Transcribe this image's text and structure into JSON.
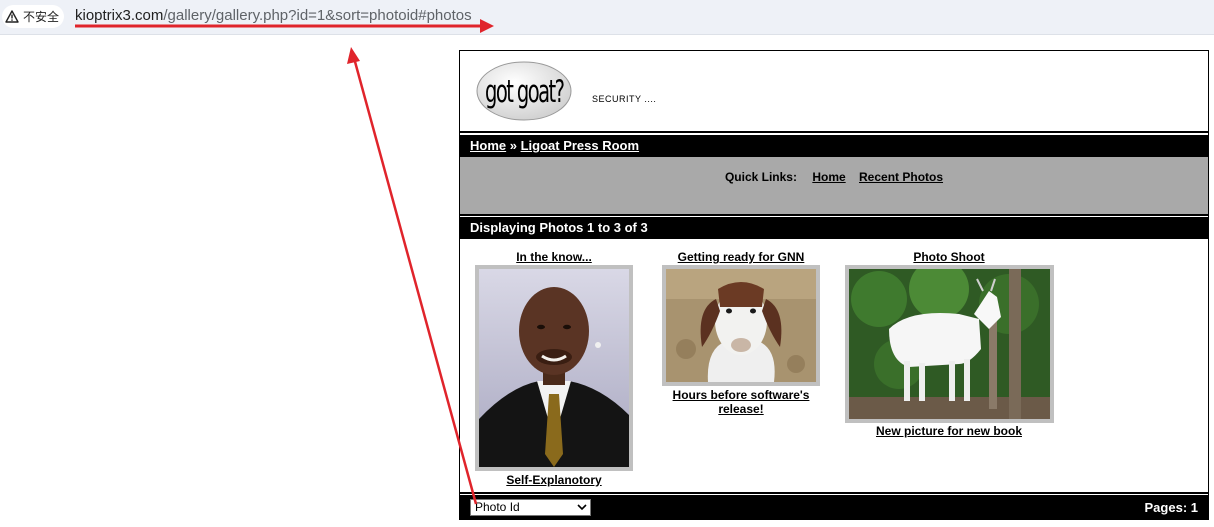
{
  "browser": {
    "security_label": "不安全",
    "url_host": "kioptrix3.com",
    "url_path": "/gallery/gallery.php?id=1&sort=photoid#photos"
  },
  "site": {
    "logo_text": "got goat?",
    "tagline": "SECURITY ...."
  },
  "breadcrumb": {
    "home": "Home",
    "separator": " » ",
    "current": "Ligoat Press Room"
  },
  "quick_links": {
    "label": "Quick Links:",
    "home": "Home",
    "recent": "Recent Photos"
  },
  "display": {
    "prefix": "Displaying Photos ",
    "from": "1",
    "to_word": " to ",
    "to": "3",
    "of_word": " of ",
    "total": "3"
  },
  "photos": [
    {
      "title": "In the know...",
      "caption": "Self-Explanotory"
    },
    {
      "title": "Getting ready for GNN",
      "caption": "Hours before software's release!"
    },
    {
      "title": "Photo Shoot",
      "caption": "New picture for new book"
    }
  ],
  "footer": {
    "sort_value": "Photo Id",
    "pages_label": "Pages: ",
    "pages_value": "1"
  },
  "colors": {
    "annotation_red": "#e0242b",
    "bar_black": "#000000",
    "quickbar_gray": "#a9a9a9"
  }
}
